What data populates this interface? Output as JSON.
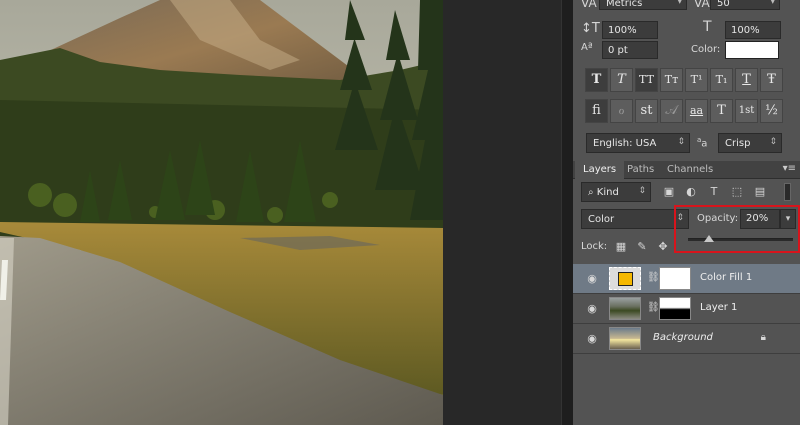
{
  "character": {
    "kerning_value": "Metrics",
    "tracking_value": "50",
    "vscale_value": "100%",
    "hscale_value": "100%",
    "baseline_value": "0 pt",
    "color_label": "Color:",
    "color_swatch": "#ffffff",
    "type_style_buttons": [
      "T",
      "T",
      "TT",
      "Tᴛ",
      "T¹",
      "T₁",
      "T",
      "Ŧ"
    ],
    "opentype_buttons": [
      "fi",
      "ℴ",
      "st",
      "𝒜",
      "aa",
      "T",
      "1st",
      "½"
    ],
    "language": "English: USA",
    "aa_label": "a",
    "antialias": "Crisp"
  },
  "layers_panel": {
    "tabs": [
      "Layers",
      "Paths",
      "Channels"
    ],
    "filter_kind": "Kind",
    "blend_mode": "Color",
    "opacity_label": "Opacity:",
    "opacity_value": "20%",
    "opacity_fraction": 0.2,
    "lock_label": "Lock:",
    "layers": [
      {
        "name": "Color Fill 1",
        "selected": true,
        "fill_color": "#f5b800"
      },
      {
        "name": "Layer 1",
        "selected": false
      },
      {
        "name": "Background",
        "selected": false,
        "locked": true
      }
    ]
  },
  "colors": {
    "highlight": "#d8141c",
    "panel_bg": "#535353",
    "selected_layer": "#6f7a86"
  }
}
